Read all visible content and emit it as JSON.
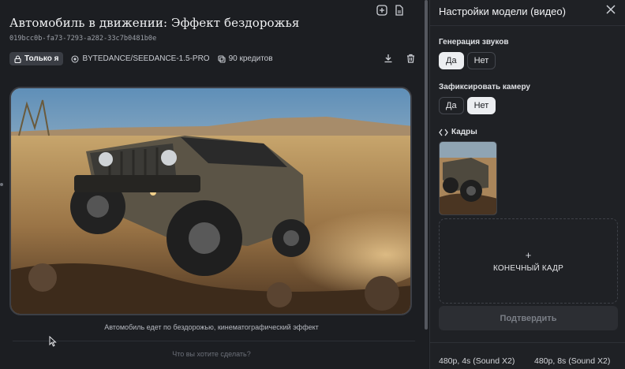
{
  "left": {
    "title": "Автомобиль в движении: Эффект бездорожья",
    "uuid": "019bcc0b-fa73-7293-a282-33c7b0481b0e",
    "badge_label": "Только я",
    "model": "BYTEDANCE/SEEDANCE-1.5-PRO",
    "credits": "90 кредитов",
    "caption": "Автомобиль едет по бездорожью, кинематографический эффект",
    "prompt_placeholder": "Что вы хотите сделать?"
  },
  "panel": {
    "title": "Настройки модели (видео)",
    "sound_label": "Генерация звуков",
    "camera_label": "Зафиксировать камеру",
    "yes": "Да",
    "no": "Нет",
    "sound_selected": "Да",
    "camera_selected": "Нет",
    "frames_label": "Кадры",
    "plus": "+",
    "end_frame": "КОНЕЧНЫЙ КАДР",
    "confirm": "Подтвердить",
    "options": [
      "480p, 4s (Sound X2)",
      "480p, 8s (Sound X2)"
    ]
  },
  "icons": [
    "add-icon",
    "file-icon",
    "lock-icon",
    "model-icon",
    "credits-icon",
    "download-icon",
    "trash-icon",
    "close-icon",
    "frames-icon"
  ]
}
